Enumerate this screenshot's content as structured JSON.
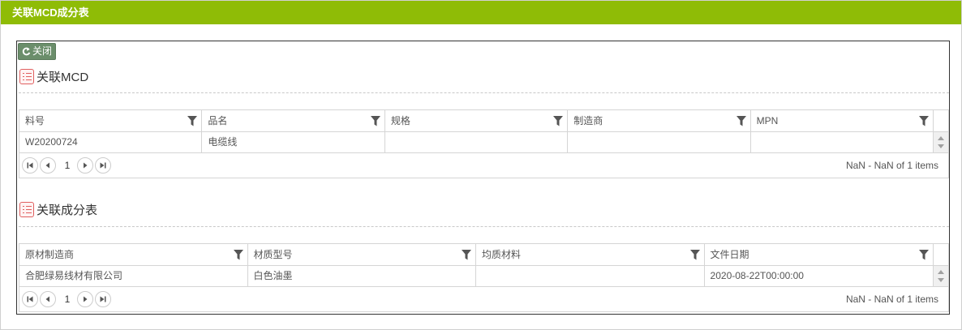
{
  "window": {
    "title": "关联MCD成分表"
  },
  "toolbar": {
    "close_label": "关闭"
  },
  "mcd_section": {
    "title": "关联MCD",
    "columns": [
      "料号",
      "品名",
      "规格",
      "制造商",
      "MPN"
    ],
    "rows": [
      [
        "W20200724",
        "电缆线",
        "",
        "",
        ""
      ]
    ],
    "pager": {
      "page": "1",
      "info": "NaN - NaN of 1 items"
    }
  },
  "composition_section": {
    "title": "关联成分表",
    "columns": [
      "原材制造商",
      "材质型号",
      "均质材料",
      "文件日期"
    ],
    "rows": [
      [
        "合肥绿易线材有限公司",
        "白色油墨",
        "",
        "2020-08-22T00:00:00"
      ]
    ],
    "pager": {
      "page": "1",
      "info": "NaN - NaN of 1 items"
    }
  },
  "colors": {
    "titlebar": "#8fbc06",
    "close_button": "#6b8e6b",
    "section_icon": "#e06060"
  },
  "icons": [
    "refresh-icon",
    "list-icon",
    "filter-icon",
    "first-page-icon",
    "prev-page-icon",
    "next-page-icon",
    "last-page-icon",
    "scroll-up-icon",
    "scroll-down-icon"
  ]
}
